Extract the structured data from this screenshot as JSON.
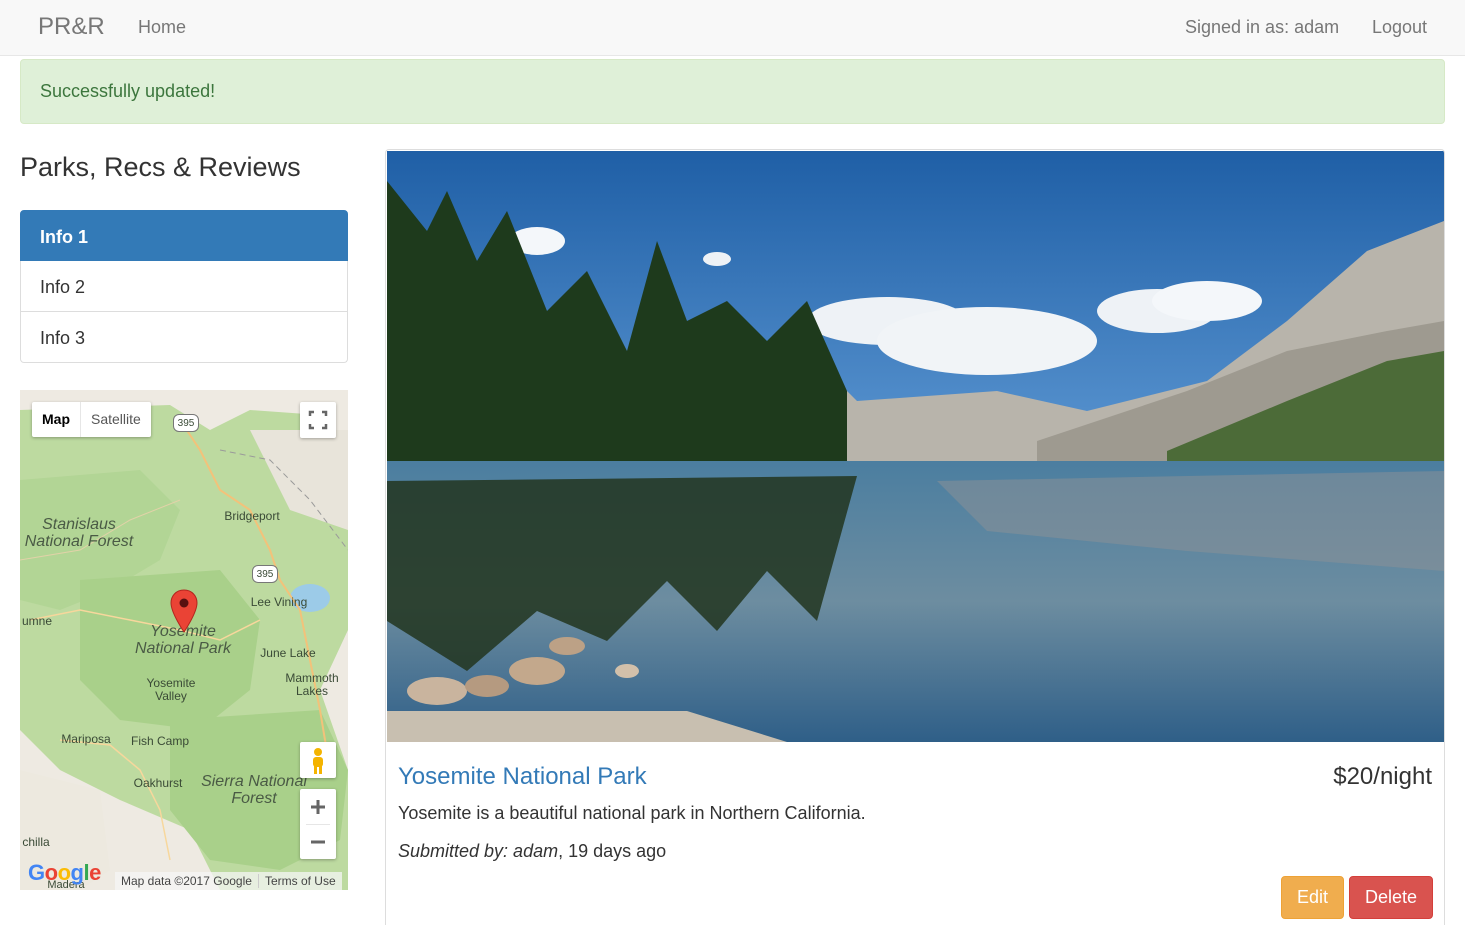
{
  "navbar": {
    "brand": "PR&R",
    "home": "Home",
    "signed_in": "Signed in as: adam",
    "logout": "Logout"
  },
  "alert": {
    "message": "Successfully updated!",
    "color": "#dff0d8"
  },
  "sidebar": {
    "title": "Parks, Recs & Reviews",
    "items": [
      {
        "label": "Info 1",
        "active": true
      },
      {
        "label": "Info 2",
        "active": false
      },
      {
        "label": "Info 3",
        "active": false
      }
    ]
  },
  "map": {
    "type_map": "Map",
    "type_satellite": "Satellite",
    "labels": {
      "stanislaus": "Stanislaus National Forest",
      "bridgeport": "Bridgeport",
      "lee_vining": "Lee Vining",
      "tuolumne": "umne",
      "yosemite": "Yosemite National Park",
      "june_lake": "June Lake",
      "mammoth": "Mammoth Lakes",
      "yosemite_valley": "Yosemite Valley",
      "mariposa": "Mariposa",
      "fish_camp": "Fish Camp",
      "oakhurst": "Oakhurst",
      "sierra": "Sierra National Forest",
      "chilla": "chilla",
      "madera": "Madera",
      "route_395_a": "395",
      "route_395_b": "395"
    },
    "google": "Google",
    "map_data": "Map data ©2017 Google",
    "terms": "Terms of Use",
    "icons": [
      "fullscreen-icon",
      "pegman-icon",
      "zoom-in-icon",
      "zoom-out-icon",
      "map-marker-icon"
    ]
  },
  "park": {
    "name": "Yosemite National Park",
    "price": "$20/night",
    "description": "Yosemite is a beautiful national park in Northern California.",
    "submitted_label": "Submitted by: adam",
    "submitted_time": ", 19 days ago",
    "edit_label": "Edit",
    "delete_label": "Delete"
  },
  "colors": {
    "primary": "#337ab7",
    "edit": "#f0ad4e",
    "delete": "#d9534f",
    "alert_text": "#3c763d"
  }
}
